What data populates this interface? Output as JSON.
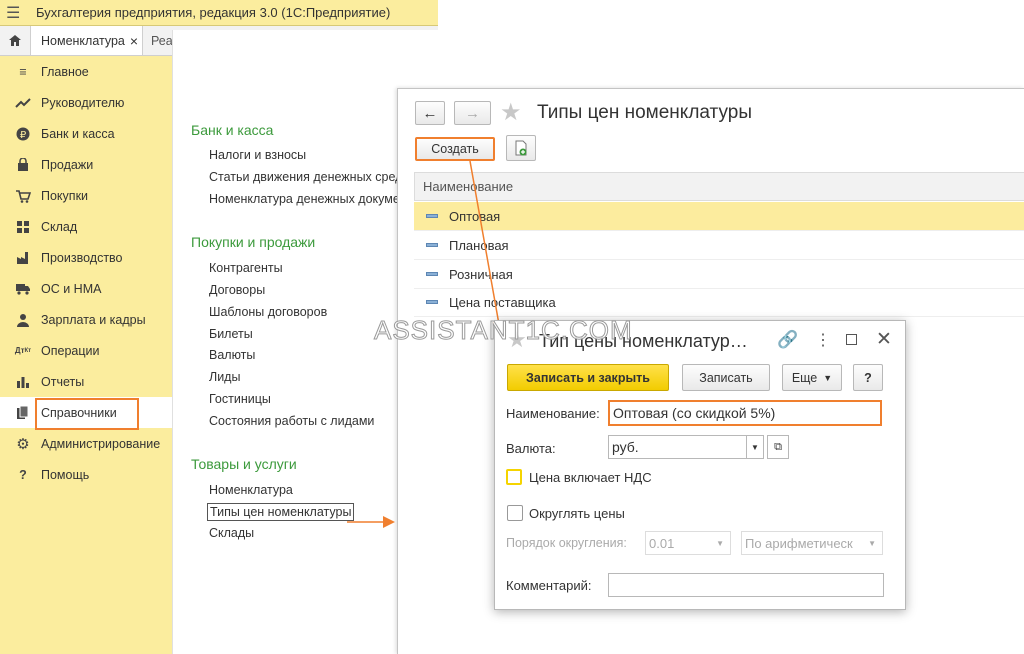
{
  "app": {
    "title": "Бухгалтерия предприятия, редакция 3.0  (1С:Предприятие)"
  },
  "tabs": {
    "home": "home-icon",
    "nomenclature": "Номенклатура",
    "close": "×",
    "partial": "Реа"
  },
  "sidebar": {
    "items": [
      {
        "label": "Главное",
        "icon": "menu-lines-icon"
      },
      {
        "label": "Руководителю",
        "icon": "trend-icon"
      },
      {
        "label": "Банк и касса",
        "icon": "ruble-coin-icon"
      },
      {
        "label": "Продажи",
        "icon": "bag-icon"
      },
      {
        "label": "Покупки",
        "icon": "cart-icon"
      },
      {
        "label": "Склад",
        "icon": "grid-icon"
      },
      {
        "label": "Производство",
        "icon": "factory-icon"
      },
      {
        "label": "ОС и НМА",
        "icon": "truck-icon"
      },
      {
        "label": "Зарплата и кадры",
        "icon": "person-icon"
      },
      {
        "label": "Операции",
        "icon": "dt-kt-icon"
      },
      {
        "label": "Отчеты",
        "icon": "bar-chart-icon"
      },
      {
        "label": "Справочники",
        "icon": "books-icon"
      },
      {
        "label": "Администрирование",
        "icon": "gear-icon"
      },
      {
        "label": "Помощь",
        "icon": "question-icon"
      }
    ]
  },
  "content": {
    "sections": [
      {
        "title": "Банк и касса",
        "links": [
          "Налоги и взносы",
          "Статьи движения денежных сред",
          "Номенклатура денежных докумен"
        ]
      },
      {
        "title": "Покупки и продажи",
        "links": [
          "Контрагенты",
          "Договоры",
          "Шаблоны договоров",
          "Билеты",
          "Валюты",
          "Лиды",
          "Гостиницы",
          "Состояния работы с лидами"
        ]
      },
      {
        "title": "Товары и услуги",
        "links": [
          "Номенклатура",
          "Типы цен номенклатуры",
          "Склады"
        ]
      }
    ]
  },
  "price_types": {
    "title": "Типы цен номенклатуры",
    "create_button": "Создать",
    "column_header": "Наименование",
    "rows": [
      "Оптовая",
      "Плановая",
      "Розничная",
      "Цена поставщика"
    ]
  },
  "watermark": "ASSISTANT1C.COM",
  "dialog": {
    "title": "Тип цены номенклатур…",
    "save_close": "Записать и закрыть",
    "save": "Записать",
    "more": "Еще",
    "help": "?",
    "name_label": "Наименование:",
    "name_value": "Оптовая (со скидкой 5%)",
    "currency_label": "Валюта:",
    "currency_value": "руб.",
    "vat_label": "Цена включает НДС",
    "round_label": "Округлять цены",
    "round_order_label": "Порядок округления:",
    "round_order_value": "0.01",
    "round_method_value": "По арифметическ",
    "comment_label": "Комментарий:",
    "comment_value": ""
  },
  "colors": {
    "accent_yellow": "#fbed9e",
    "highlight": "#f07f2e",
    "green_title": "#3c9a3c",
    "save_button": "#f5d400"
  }
}
